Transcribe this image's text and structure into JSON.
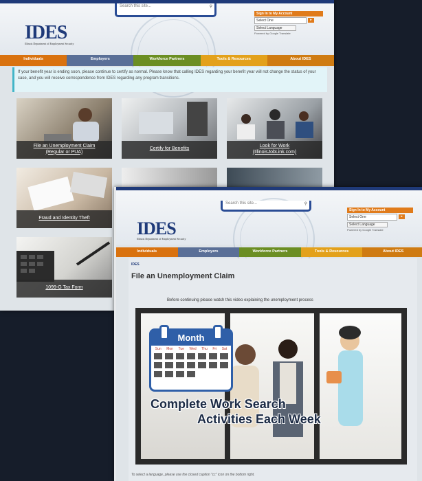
{
  "window1": {
    "search_placeholder": "Search this site...",
    "signin": {
      "label": "Sign In to My Account",
      "select": "Select One",
      "language": "Select Language",
      "powered": "Powered by Google Translate"
    },
    "logo": {
      "text": "IDES",
      "subtitle": "Illinois Department of Employment Security"
    },
    "nav": [
      "Individuals",
      "Employers",
      "Workforce Partners",
      "Tools & Resources",
      "About IDES"
    ],
    "notice": "If your benefit year is ending soon, please continue to certify as normal. Please know that calling IDES regarding your benefit year will not change the status of your case, and you will receive correspondence from IDES regarding any program transitions.",
    "tiles": [
      {
        "line1": "File an Unemployment Claim",
        "line2": "(Regular or PUA)"
      },
      {
        "line1": "Certify for Benefits",
        "line2": ""
      },
      {
        "line1": "Look for Work",
        "line2": "(IllinoisJobLink.com)"
      },
      {
        "line1": "Fraud and Identity Theft",
        "line2": ""
      },
      {
        "line1": "",
        "line2": ""
      },
      {
        "line1": "",
        "line2": ""
      },
      {
        "line1": "1099-G Tax Form",
        "line2": ""
      }
    ]
  },
  "window2": {
    "search_placeholder": "Search this site...",
    "signin": {
      "label": "Sign In to My Account",
      "select": "Select One",
      "language": "Select Language",
      "powered": "Powered by Google Translate"
    },
    "logo": {
      "text": "IDES",
      "subtitle": "Illinois Department of Employment Security"
    },
    "nav": [
      "Individuals",
      "Employers",
      "Workforce Partners",
      "Tools & Resources",
      "About IDES"
    ],
    "breadcrumb": "IDES",
    "title": "File an Unemployment Claim",
    "intro": "Before continuing please watch this video explaining the unemployment process",
    "video": {
      "calendar_month": "Month",
      "days": [
        "Sun",
        "Mon",
        "Tue",
        "Wed",
        "Thu",
        "Fri",
        "Sat"
      ],
      "caption_line1": "Complete Work Search",
      "caption_line2": "Activities Each Week"
    },
    "footer_note": "To select a language, please use the closed caption \"cc\" icon on the bottom right."
  },
  "colors": {
    "brand_blue": "#1f3a79",
    "orange": "#e07b1b",
    "green": "#6b8e23",
    "gold": "#e3a11b"
  }
}
